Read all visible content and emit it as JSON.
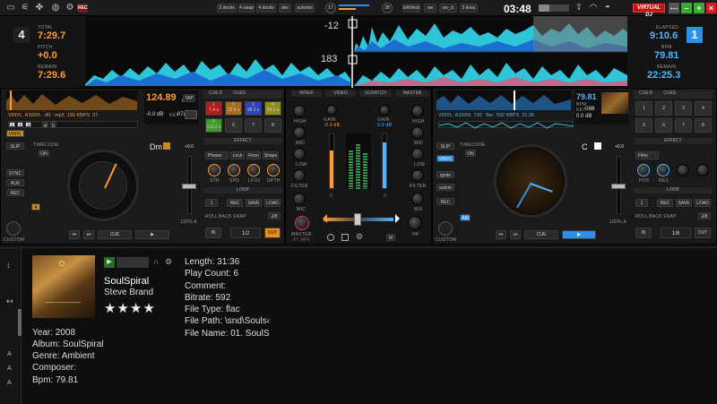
{
  "topbar": {
    "rec": "REC",
    "layouts": [
      "2 decks",
      "4 swap",
      "4 decks",
      "dev",
      "automix"
    ],
    "knob_left": "17",
    "knob_right": "28",
    "fx_buttons": [
      "left/deck",
      "sw",
      "sw_ct",
      "5 lines"
    ],
    "clock": "03:48",
    "brand": "VIRTUAL DJ",
    "colors": {
      "accent_orange": "#ff9a2e",
      "accent_blue": "#2d8fe6",
      "rec_red": "#8a1111"
    }
  },
  "wave": {
    "left_deck_num": "4",
    "total_label": "TOTAL",
    "total": "7:29.7",
    "pitch_label": "PITCH",
    "pitch": "+0.0",
    "remain_label": "REMAIN",
    "remain": "7:29.6",
    "marker_top": "-12",
    "marker_bottom": "183",
    "right_deck_num": "1",
    "elapsed_label": "ELAPSED",
    "elapsed": "9:10.6",
    "bpm_label": "BPM",
    "bpm": "79.81",
    "remain2_label": "REMAIN",
    "remain2": "22:25.3"
  },
  "left_deck": {
    "mode": "VINYL",
    "pitch": "A100%",
    "pitch_val": "-40",
    "format": "mp3",
    "bitrate": "192 KBPS",
    "time": "07",
    "bpm": "124.89",
    "bpm_label": "BPM",
    "gain": "-0.0 dB",
    "key_label": "KEY",
    "key": "07A",
    "tap": "TAP",
    "cue_header": "CUE 8",
    "cues_label": "CUES",
    "pads": [
      {
        "n": "1",
        "t": "7.4 s"
      },
      {
        "n": "2",
        "t": "23.8 s"
      },
      {
        "n": "3",
        "t": "38.3 s"
      },
      {
        "n": "4",
        "t": "94.5 s"
      },
      {
        "n": "5",
        "t": "115.2 s"
      },
      {
        "n": "6",
        "t": ""
      },
      {
        "n": "7",
        "t": ""
      },
      {
        "n": "8",
        "t": ""
      }
    ],
    "slip": "SLIP",
    "vinyl": "VINYL",
    "timecode": "TIMECODE",
    "on": "ON",
    "sync_btns": [
      "SYNC",
      "AUX",
      "REC"
    ],
    "beat_nums": [
      "1",
      "2",
      "3",
      "4",
      "5"
    ],
    "key_display": "Dm",
    "pitch_offset": "+0.0",
    "effect_hdr": "EFFECT",
    "effect": "Phaser",
    "effect_btns": [
      "Lock",
      "Reso",
      "Shape"
    ],
    "effect_knobs": [
      "STR",
      "SPD",
      "LFO2",
      "DPTH"
    ],
    "loop_hdr": "LOOP",
    "loop_size": "1",
    "loop_btns": [
      "REC",
      "SAVE",
      "LOAD"
    ],
    "loop_btns2": [
      "ROLL",
      "BACK",
      "SNAP",
      "2/8"
    ],
    "loop_in": "IN",
    "loop_val": "1/2",
    "loop_out": "OUT",
    "pitch_range": "100% A",
    "custom": "CUSTOM",
    "cue": "CUE",
    "play": "▶"
  },
  "mixer": {
    "tabs": [
      "MIXER",
      "VIDEO",
      "SCRATCH",
      "MASTER"
    ],
    "gain_label": "GAIN",
    "gain_left": "-0.0 dB",
    "gain_right": "0.0 dB",
    "hi": "HIGH",
    "mid": "MID",
    "low": "LOW",
    "filter": "FILTER",
    "mic": "MIC",
    "master": "MASTER",
    "master_val": "47.34%",
    "hp": "HP",
    "mix": "MIX"
  },
  "right_deck": {
    "mode": "VINYL",
    "pitch": "A100%",
    "pitch_val": "730",
    "format": "flac",
    "bitrate": "592 KBPS",
    "time": "31:36",
    "bpm": "79.81",
    "bpm_label": "BPM",
    "gain": "0.0 dB",
    "key_label": "KEY",
    "key": "08B",
    "cue_header": "CUE 8",
    "cues_label": "CUES",
    "pads": [
      {
        "n": "1",
        "t": ""
      },
      {
        "n": "2",
        "t": ""
      },
      {
        "n": "3",
        "t": ""
      },
      {
        "n": "4",
        "t": ""
      },
      {
        "n": "5",
        "t": ""
      },
      {
        "n": "6",
        "t": ""
      },
      {
        "n": "7",
        "t": ""
      },
      {
        "n": "8",
        "t": ""
      }
    ],
    "slip": "SLIP",
    "vinyl": "VINYL",
    "timecode": "TIMECODE",
    "on": "ON",
    "sync_btns": [
      "ignite",
      "autom",
      "REC",
      "AM"
    ],
    "key_display": "C",
    "pitch_offset": "+0.0",
    "effect_hdr": "EFFECT",
    "effect": "Filter",
    "effect_knobs": [
      "POS",
      "RES"
    ],
    "loop_hdr": "LOOP",
    "loop_size": "1",
    "loop_btns": [
      "REC",
      "SAVE",
      "LOAD"
    ],
    "loop_btns2": [
      "ROLL",
      "BACK",
      "SNAP",
      "2/8"
    ],
    "loop_in": "IN",
    "loop_val": "1/8",
    "loop_out": "OUT",
    "pitch_range": "100% A",
    "custom": "CUSTOM",
    "cue": "CUE",
    "play": "▶"
  },
  "browser": {
    "title": "SoulSpiral",
    "artist": "Steve Brand",
    "rating": "★★★★",
    "year": "Year: 2008",
    "album": "Album: SoulSpiral",
    "genre": "Genre: Ambient",
    "composer": "Composer:",
    "bpm": "Bpm: 79.81",
    "length": "Length: 31:36",
    "playcount": "Play Count: 6",
    "comment": "Comment:",
    "bitrate": "Bitrate: 592",
    "filetype": "File Type: flac",
    "filepath": "File Path: \\snd\\Souls‹",
    "filename": "File Name: 01. SoulS",
    "side_letters": [
      "A",
      "A",
      "A"
    ]
  }
}
